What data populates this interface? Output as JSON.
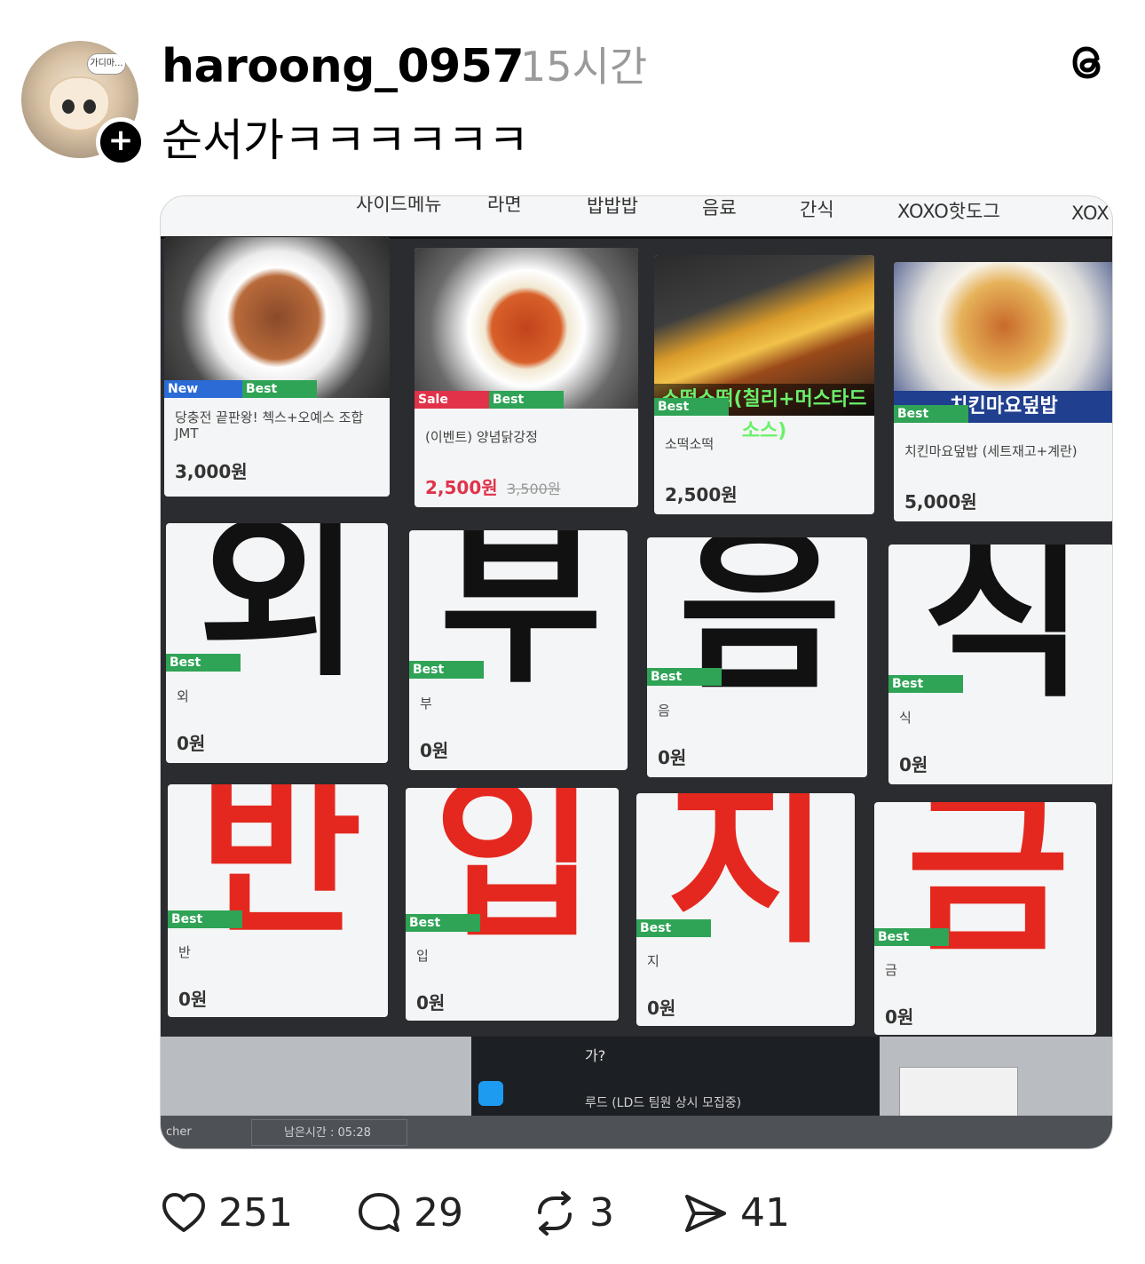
{
  "post": {
    "username": "haroong_0957",
    "time": "15시간",
    "text": "순서가ㅋㅋㅋㅋㅋㅋ",
    "avatar_bubble": "가디마..."
  },
  "kiosk": {
    "tabs": [
      "사이드메뉴",
      "라면",
      "밥밥밥",
      "음료",
      "간식",
      "XOXO핫도그",
      "XOX"
    ],
    "food_cards": [
      {
        "badges": [
          "New",
          "Best"
        ],
        "name": "당충전 끝판왕! 첵스+오예스 조합 JMT",
        "price": "3,000원"
      },
      {
        "badges": [
          "Sale",
          "Best"
        ],
        "name": "(이벤트) 양념닭강정",
        "price": "2,500원",
        "old_price": "3,500원"
      },
      {
        "badges": [
          "Best"
        ],
        "overlay": "소떡소떡(칠리+머스타드소스)",
        "name": "소떡소떡",
        "price": "2,500원"
      },
      {
        "badges": [
          "Best"
        ],
        "overlay": "치킨마요덮밥",
        "name": "치킨마요덮밥 (세트재고+계란)",
        "price": "5,000원"
      }
    ],
    "row2": [
      {
        "char": "외",
        "badge": "Best",
        "name": "외",
        "price": "0원"
      },
      {
        "char": "부",
        "badge": "Best",
        "name": "부",
        "price": "0원"
      },
      {
        "char": "음",
        "badge": "Best",
        "name": "음",
        "price": "0원"
      },
      {
        "char": "식",
        "badge": "Best",
        "name": "식",
        "price": "0원"
      }
    ],
    "row3": [
      {
        "char": "반",
        "badge": "Best",
        "name": "반",
        "price": "0원"
      },
      {
        "char": "입",
        "badge": "Best",
        "name": "입",
        "price": "0원"
      },
      {
        "char": "지",
        "badge": "Best",
        "name": "지",
        "price": "0원"
      },
      {
        "char": "금",
        "badge": "Best",
        "name": "금",
        "price": "0원"
      }
    ],
    "taskbar": {
      "launcher": "cher",
      "remaining": "남은시간 : 05:28"
    },
    "panel": {
      "line1": "가?",
      "line2": "루드 (LD드 팀원 상시 모집중)"
    }
  },
  "actions": {
    "likes": "251",
    "replies": "29",
    "reposts": "3",
    "shares": "41"
  },
  "colors": {
    "badge_new": "#2a6bd6",
    "badge_sale": "#e0334a",
    "badge_best": "#2fa356",
    "text_red": "#e4281f"
  }
}
